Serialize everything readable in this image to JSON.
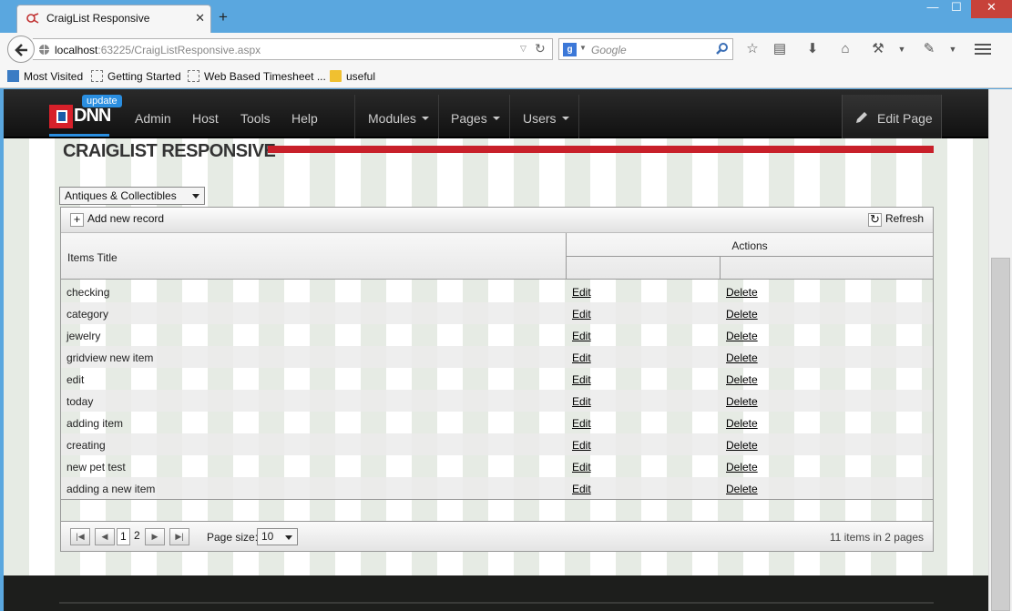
{
  "browser": {
    "tab_title": "CraigList Responsive",
    "tab_close": "✕",
    "new_tab": "+",
    "url_host": "localhost",
    "url_rest": ":63225/CraigListResponsive.aspx",
    "search_engine": "g",
    "search_placeholder": "Google",
    "win_min": "—",
    "win_max": "☐",
    "win_close": "✕",
    "bookmarks": [
      "Most Visited",
      "Getting Started",
      "Web Based Timesheet ...",
      "useful"
    ]
  },
  "dnn": {
    "logo_text": "DNN",
    "update_badge": "update",
    "nav": [
      "Admin",
      "Host",
      "Tools",
      "Help"
    ],
    "menus": [
      "Modules",
      "Pages",
      "Users"
    ],
    "edit_page": "Edit Page"
  },
  "page": {
    "title": "CRAIGLIST RESPONSIVE",
    "category_selected": "Antiques & Collectibles"
  },
  "grid": {
    "add_label": "Add new record",
    "refresh_label": "Refresh",
    "col_title": "Items Title",
    "col_actions": "Actions",
    "edit_label": "Edit",
    "delete_label": "Delete",
    "rows": [
      "checking",
      "category",
      "jewelry",
      "gridview new item",
      "edit",
      "today",
      "adding item",
      "creating",
      "new pet test",
      "adding a new item"
    ]
  },
  "pager": {
    "pages": [
      "1",
      "2"
    ],
    "current_page": "1",
    "page_size_label": "Page size:",
    "page_size": "10",
    "info": "11 items in 2 pages"
  },
  "colors": {
    "accent_red": "#c8202a",
    "dnn_blue": "#2a8ee0",
    "titlebar": "#5aa7df"
  }
}
